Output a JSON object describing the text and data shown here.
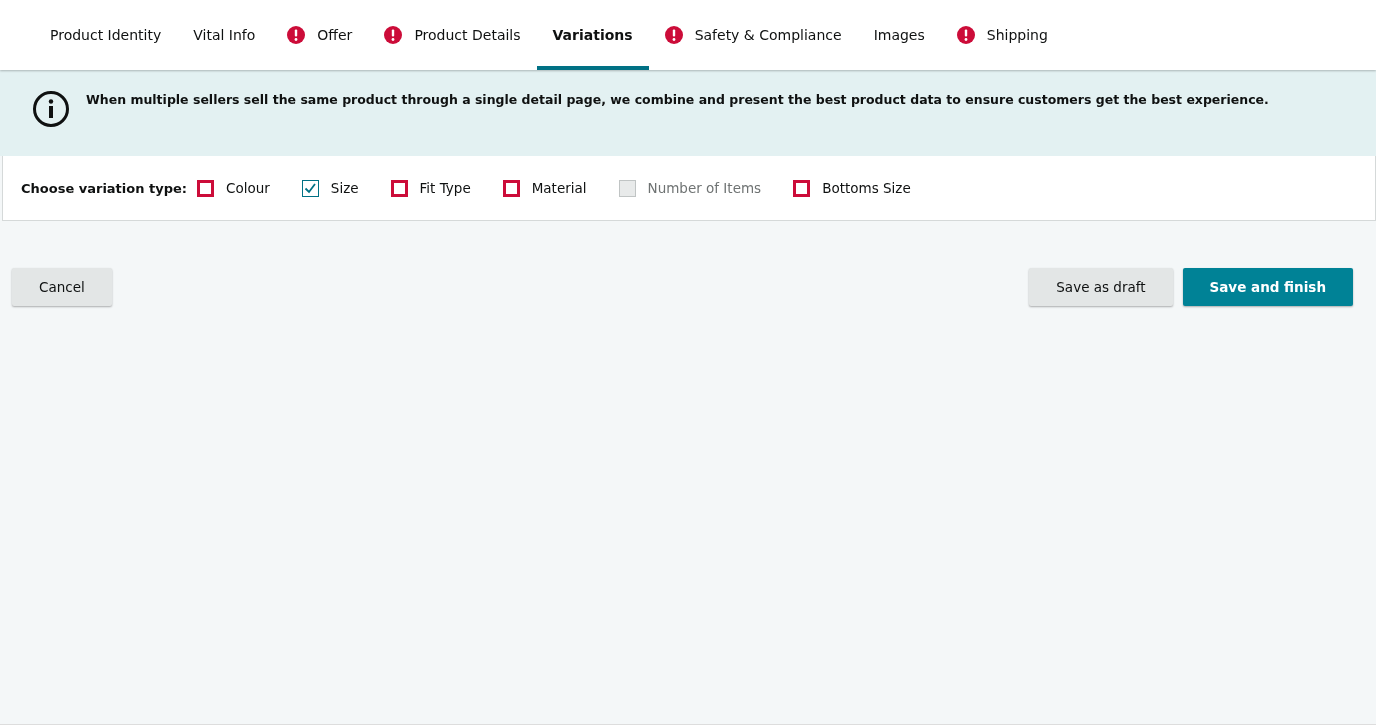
{
  "tabs": [
    {
      "label": "Product Identity",
      "alert": false,
      "selected": false
    },
    {
      "label": "Vital Info",
      "alert": false,
      "selected": false
    },
    {
      "label": "Offer",
      "alert": true,
      "selected": false
    },
    {
      "label": "Product Details",
      "alert": true,
      "selected": false
    },
    {
      "label": "Variations",
      "alert": false,
      "selected": true
    },
    {
      "label": "Safety & Compliance",
      "alert": true,
      "selected": false
    },
    {
      "label": "Images",
      "alert": false,
      "selected": false
    },
    {
      "label": "Shipping",
      "alert": true,
      "selected": false
    }
  ],
  "info": {
    "message": "When multiple sellers sell the same product through a single detail page, we combine and present the best product data to ensure customers get the best experience."
  },
  "variation": {
    "label": "Choose variation type:",
    "options": [
      {
        "label": "Colour",
        "kind": "invalid",
        "checked": false,
        "disabled": false
      },
      {
        "label": "Size",
        "kind": "plain",
        "checked": true,
        "disabled": false
      },
      {
        "label": "Fit Type",
        "kind": "invalid",
        "checked": false,
        "disabled": false
      },
      {
        "label": "Material",
        "kind": "invalid",
        "checked": false,
        "disabled": false
      },
      {
        "label": "Number of Items",
        "kind": "plain",
        "checked": false,
        "disabled": true
      },
      {
        "label": "Bottoms Size",
        "kind": "invalid",
        "checked": false,
        "disabled": false
      }
    ]
  },
  "buttons": {
    "cancel": "Cancel",
    "draft": "Save as draft",
    "finish": "Save and finish"
  }
}
